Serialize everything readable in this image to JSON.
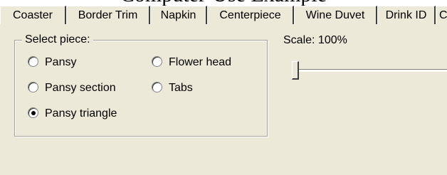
{
  "caption": "Computer-Use Example",
  "tabs": [
    "Coaster",
    "Border Trim",
    "Napkin",
    "Centerpiece",
    "Wine Duvet",
    "Drink ID",
    "C"
  ],
  "group": {
    "label": "Select piece:",
    "options": [
      "Pansy",
      "Flower head",
      "Pansy section",
      "Tabs",
      "Pansy triangle"
    ],
    "selected": "Pansy triangle"
  },
  "scale": {
    "label": "Scale: 100%",
    "percent": 100,
    "slider_position_fraction": 0.0
  }
}
